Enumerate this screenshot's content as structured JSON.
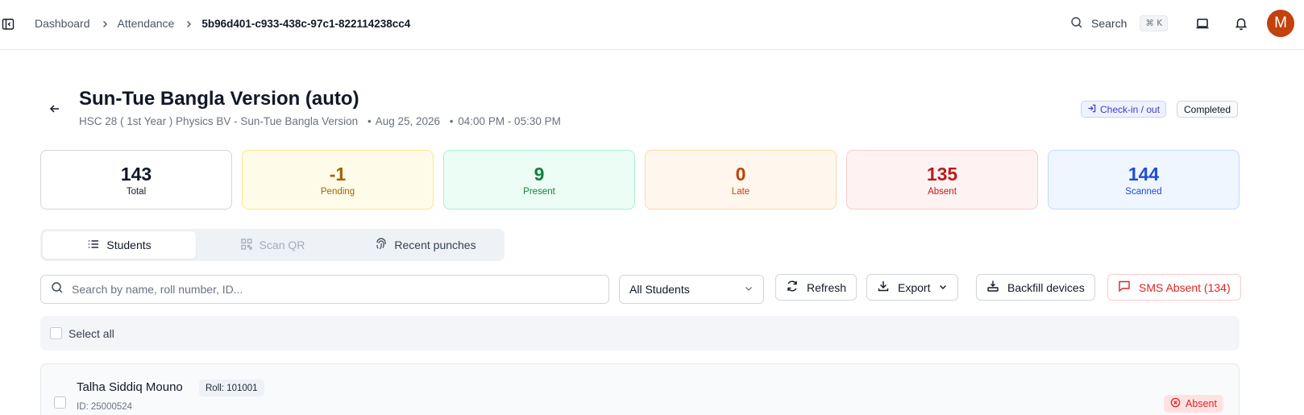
{
  "breadcrumb": {
    "items": [
      "Dashboard",
      "Attendance"
    ],
    "current": "5b96d401-c933-438c-97c1-822114238cc4"
  },
  "topbar": {
    "search_label": "Search",
    "shortcut": "⌘ K",
    "avatar_initial": "M"
  },
  "header": {
    "title": "Sun-Tue Bangla Version (auto)",
    "course": "HSC 28 ( 1st Year ) Physics BV - Sun-Tue Bangla Version",
    "date": "Aug 25, 2026",
    "time": "04:00 PM - 05:30 PM",
    "dot": "•",
    "mode_badge": "Check-in / out",
    "status_badge": "Completed"
  },
  "stats": [
    {
      "value": "143",
      "label": "Total"
    },
    {
      "value": "-1",
      "label": "Pending"
    },
    {
      "value": "9",
      "label": "Present"
    },
    {
      "value": "0",
      "label": "Late"
    },
    {
      "value": "135",
      "label": "Absent"
    },
    {
      "value": "144",
      "label": "Scanned"
    }
  ],
  "tabs": [
    "Students",
    "Scan QR",
    "Recent punches"
  ],
  "toolbar": {
    "search_placeholder": "Search by name, roll number, ID...",
    "filter_value": "All Students",
    "refresh_label": "Refresh",
    "export_label": "Export",
    "backfill_label": "Backfill devices",
    "sms_label": "SMS Absent (134)"
  },
  "select_all_label": "Select all",
  "students": [
    {
      "name": "Talha Siddiq Mouno",
      "roll": "Roll: 101001",
      "id": "ID: 25000524",
      "status": "Absent"
    }
  ],
  "colors": {
    "total": {
      "text": "#111827",
      "bg": "#ffffff",
      "border": "#d1d5db"
    },
    "pending": {
      "text": "#a16207",
      "bg": "#fefce8",
      "border": "#fde68a"
    },
    "present": {
      "text": "#15803d",
      "bg": "#ecfdf5",
      "border": "#a7f3d0"
    },
    "late": {
      "text": "#c2410c",
      "bg": "#fff7ed",
      "border": "#fed7aa"
    },
    "absent": {
      "text": "#b91c1c",
      "bg": "#fef2f2",
      "border": "#fecaca"
    },
    "scanned": {
      "text": "#1d4ed8",
      "bg": "#eff6ff",
      "border": "#bfdbfe"
    },
    "avatar": "#c2410c",
    "danger": "#dc2626"
  }
}
